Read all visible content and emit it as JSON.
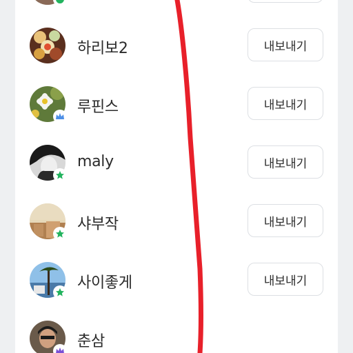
{
  "members": [
    {
      "name": "",
      "button_label": "",
      "badge": "shield-badge-icon"
    },
    {
      "name": "하리보2",
      "button_label": "내보내기",
      "badge": ""
    },
    {
      "name": "루핀스",
      "button_label": "내보내기",
      "badge": "crown-badge-icon"
    },
    {
      "name": "maly",
      "button_label": "내보내기",
      "badge": "star-badge-icon"
    },
    {
      "name": "샤부작",
      "button_label": "내보내기",
      "badge": "star-badge-icon"
    },
    {
      "name": "사이좋게",
      "button_label": "내보내기",
      "badge": "star-badge-icon"
    },
    {
      "name": "춘삼",
      "button_label": "",
      "badge": "crown-badge-icon"
    }
  ],
  "colors": {
    "annotation_stroke": "#e8202a",
    "crown_badge": "#4d8fe6",
    "star_badge": "#22b35e",
    "crown_badge_purple": "#7a4fd6"
  }
}
